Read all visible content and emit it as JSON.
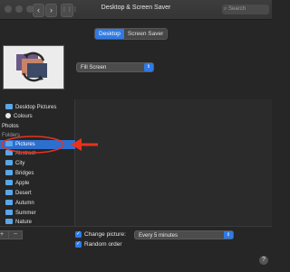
{
  "window": {
    "title": "Desktop & Screen Saver",
    "search_placeholder": "Search",
    "nav_back": "‹",
    "nav_forward": "›",
    "grid": "⋮⋮⋮"
  },
  "tabs": [
    {
      "label": "Desktop",
      "selected": true
    },
    {
      "label": "Screen Saver",
      "selected": false
    }
  ],
  "fit": {
    "value": "Fill Screen"
  },
  "sidebar": {
    "items_top": [
      {
        "label": "Desktop Pictures",
        "icon": "folder-icon"
      },
      {
        "label": "Colours",
        "icon": "color-wheel-icon"
      }
    ],
    "section_photos": "Photos",
    "section_folders": "Folders",
    "folders": [
      {
        "label": "Pictures",
        "selected": true
      },
      {
        "label": "Abstract"
      },
      {
        "label": "City"
      },
      {
        "label": "Bridges"
      },
      {
        "label": "Apple"
      },
      {
        "label": "Desert"
      },
      {
        "label": "Autumn"
      },
      {
        "label": "Summer"
      },
      {
        "label": "Nature"
      }
    ]
  },
  "bottom": {
    "add": "+",
    "remove": "−",
    "change_picture_label": "Change picture:",
    "change_picture_checked": true,
    "interval": "Every 5 minutes",
    "random_order_label": "Random order",
    "random_order_checked": true,
    "help": "?"
  },
  "annotation_colors": {
    "arrow": "#e8321e",
    "circle": "#e8321e",
    "accent": "#2f7ae5"
  }
}
